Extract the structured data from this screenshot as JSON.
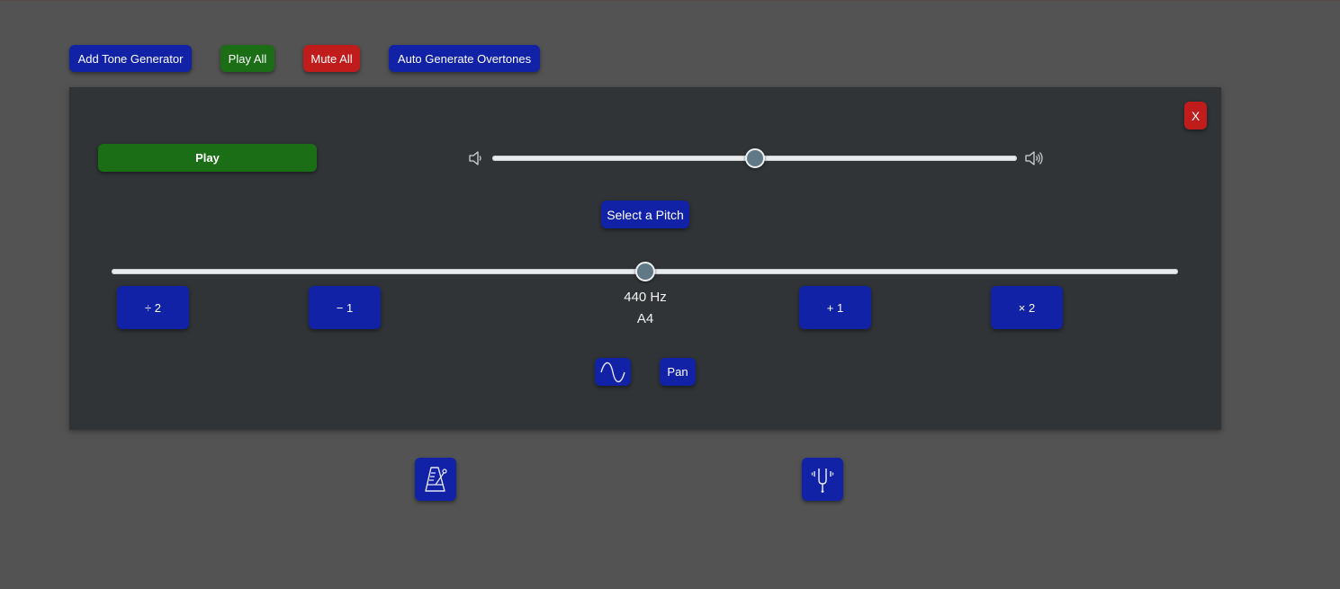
{
  "toolbar": {
    "add_tone_generator": "Add Tone Generator",
    "play_all": "Play All",
    "mute_all": "Mute All",
    "auto_generate_overtones": "Auto Generate Overtones"
  },
  "generator": {
    "close_label": "X",
    "play_label": "Play",
    "volume_level": 0.5,
    "select_pitch_label": "Select a Pitch",
    "frequency_slider_level": 0.5,
    "frequency": "440 Hz",
    "note": "A4",
    "divide_label": "÷ 2",
    "minus_label": "− 1",
    "plus_label": "+ 1",
    "times_label": "× 2",
    "waveform_icon": "sine-wave-icon",
    "pan_label": "Pan"
  },
  "bottom_tools": {
    "metronome_icon": "metronome-icon",
    "tuning_fork_icon": "tuning-fork-icon"
  },
  "colors": {
    "background": "#535353",
    "panel": "#303436",
    "blue_button": "#1122a6",
    "green_button": "#1b6e15",
    "red_button": "#c01c1c"
  }
}
